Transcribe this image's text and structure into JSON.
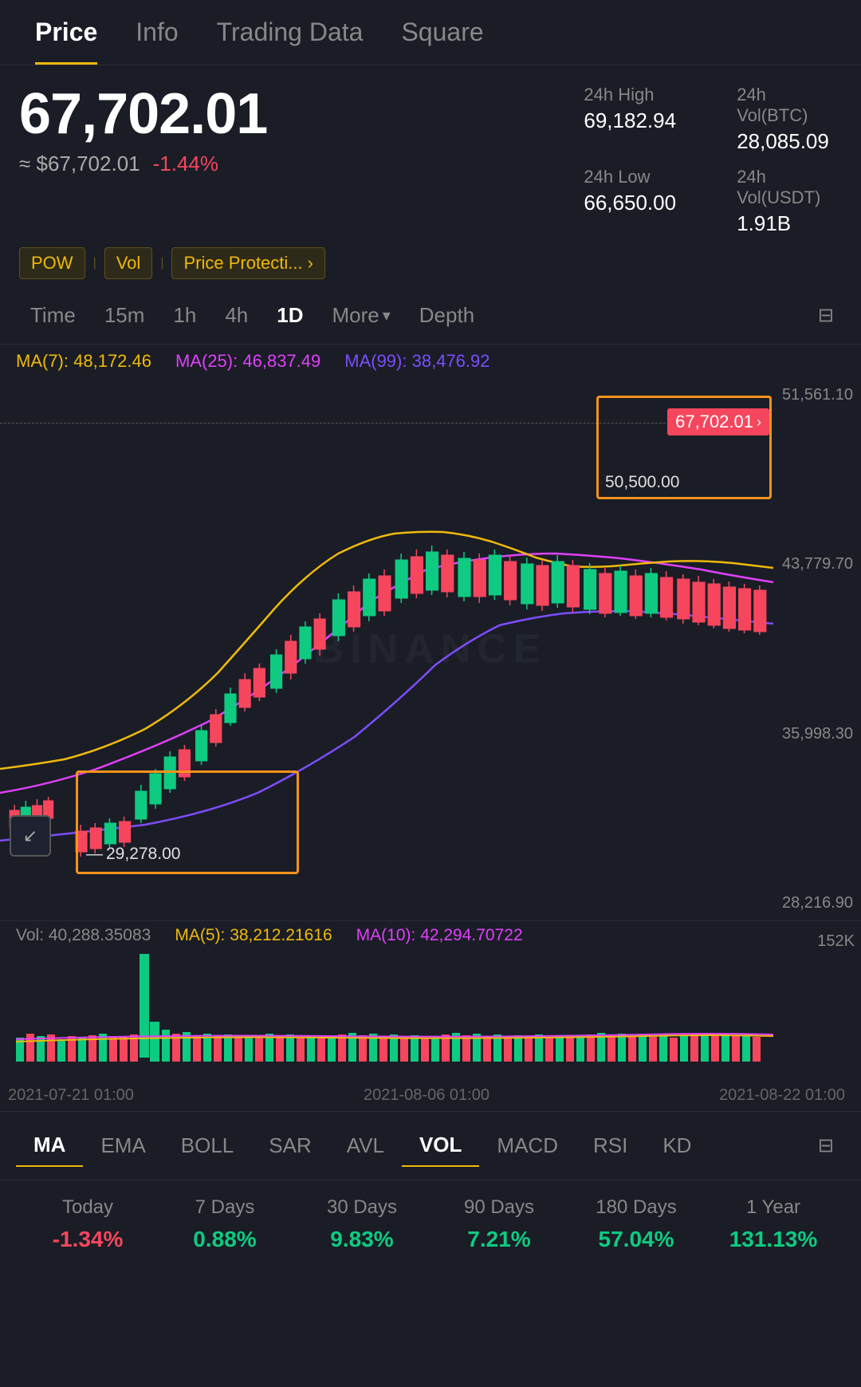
{
  "nav": {
    "tabs": [
      {
        "label": "Price",
        "active": true
      },
      {
        "label": "Info",
        "active": false
      },
      {
        "label": "Trading Data",
        "active": false
      },
      {
        "label": "Square",
        "active": false
      }
    ]
  },
  "price": {
    "main": "67,702.01",
    "usd": "≈ $67,702.01",
    "change": "-1.44%",
    "high_label": "24h High",
    "high_value": "69,182.94",
    "vol_btc_label": "24h Vol(BTC)",
    "vol_btc_value": "28,085.09",
    "low_label": "24h Low",
    "low_value": "66,650.00",
    "vol_usdt_label": "24h Vol(USDT)",
    "vol_usdt_value": "1.91B"
  },
  "tags": [
    {
      "label": "POW"
    },
    {
      "label": "Vol"
    },
    {
      "label": "Price Protecti..."
    }
  ],
  "timeframes": {
    "items": [
      "Time",
      "15m",
      "1h",
      "4h",
      "1D",
      "More ▾",
      "Depth"
    ],
    "active": "1D"
  },
  "ma_indicators": {
    "ma7_label": "MA(7):",
    "ma7_value": "48,172.46",
    "ma25_label": "MA(25):",
    "ma25_value": "46,837.49",
    "ma99_label": "MA(99):",
    "ma99_value": "38,476.92"
  },
  "chart": {
    "price_levels": [
      "51,561.10",
      "43,779.70",
      "35,998.30",
      "28,216.90"
    ],
    "current_price": "67,702.01",
    "annotation_upper": "50,500.00",
    "annotation_lower": "29,278.00",
    "watermark": "BINANCE"
  },
  "volume": {
    "vol_label": "Vol:",
    "vol_value": "40,288.35083",
    "ma5_label": "MA(5):",
    "ma5_value": "38,212.21616",
    "ma10_label": "MA(10):",
    "ma10_value": "42,294.70722",
    "max_label": "152K"
  },
  "xaxis": {
    "dates": [
      "2021-07-21 01:00",
      "2021-08-06 01:00",
      "2021-08-22 01:00"
    ]
  },
  "indicators": {
    "tabs": [
      "MA",
      "EMA",
      "BOLL",
      "SAR",
      "AVL",
      "VOL",
      "MACD",
      "RSI",
      "KD"
    ],
    "active": [
      "MA",
      "VOL"
    ]
  },
  "performance": {
    "headers": [
      "Today",
      "7 Days",
      "30 Days",
      "90 Days",
      "180 Days",
      "1 Year"
    ],
    "values": [
      "-1.34%",
      "0.88%",
      "9.83%",
      "7.21%",
      "57.04%",
      "131.13%"
    ],
    "positive": [
      false,
      true,
      true,
      true,
      true,
      true
    ]
  }
}
